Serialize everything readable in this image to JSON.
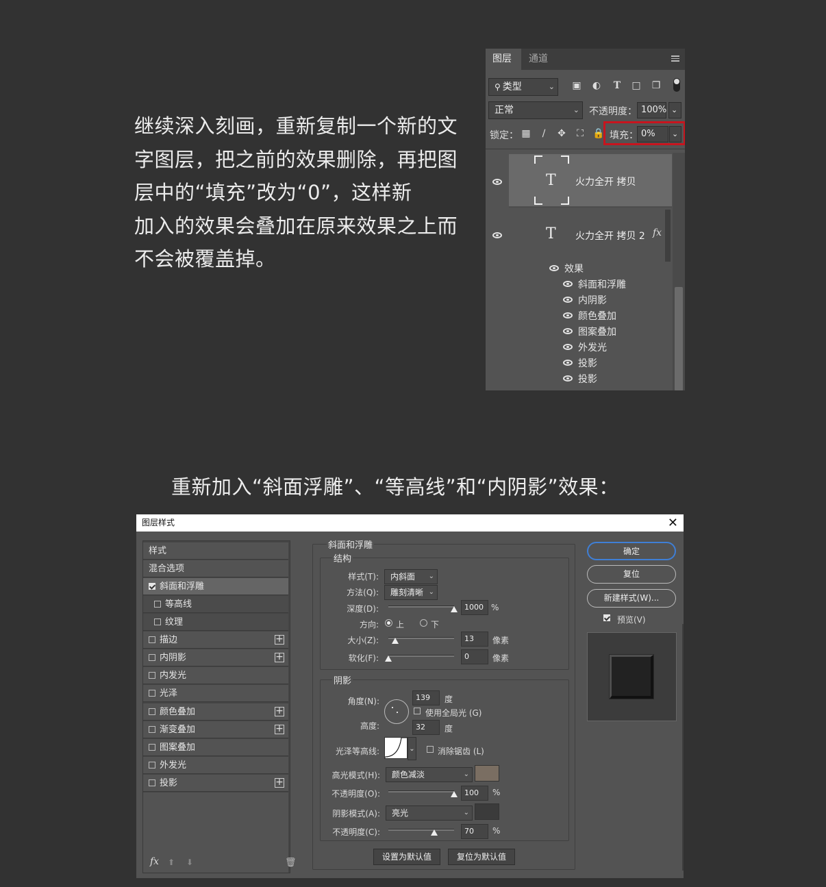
{
  "paragraph_lines": [
    "继续深入刻画，重新复制一个新的文",
    "字图层，把之前的效果删除，再把图",
    "层中的“填充”改为“0”，这样新",
    "加入的效果会叠加在原来效果之上而",
    "不会被覆盖掉。"
  ],
  "heading2": "重新加入“斜面浮雕”、“等高线”和“内阴影”效果：",
  "layers_panel": {
    "tabs": [
      "图层",
      "通道"
    ],
    "filter": {
      "search_icon": "search-icon",
      "value": "类型"
    },
    "blend_mode": "正常",
    "opacity_label": "不透明度：",
    "opacity_value": "100%",
    "lock_label": "锁定：",
    "fill_label": "填充：",
    "fill_value": "0%",
    "layers": [
      {
        "name": "火力全开 拷贝",
        "selected": true
      },
      {
        "name": "火力全开 拷贝 2",
        "fx": "fx"
      }
    ],
    "effects_label": "效果",
    "effects": [
      "斜面和浮雕",
      "内阴影",
      "颜色叠加",
      "图案叠加",
      "外发光",
      "投影",
      "投影"
    ]
  },
  "dialog": {
    "title": "图层样式",
    "left_items": [
      {
        "label": "样式",
        "type": "header"
      },
      {
        "label": "混合选项",
        "type": "header"
      },
      {
        "label": "斜面和浮雕",
        "checked": true,
        "selected": true
      },
      {
        "label": "等高线",
        "checked": false,
        "sub": true
      },
      {
        "label": "纹理",
        "checked": false,
        "sub": true
      },
      {
        "label": "描边",
        "checked": false,
        "plus": true
      },
      {
        "label": "内阴影",
        "checked": false,
        "plus": true
      },
      {
        "label": "内发光",
        "checked": false
      },
      {
        "label": "光泽",
        "checked": false
      },
      {
        "label": "颜色叠加",
        "checked": false,
        "plus": true
      },
      {
        "label": "渐变叠加",
        "checked": false,
        "plus": true
      },
      {
        "label": "图案叠加",
        "checked": false
      },
      {
        "label": "外发光",
        "checked": false
      },
      {
        "label": "投影",
        "checked": false,
        "plus": true
      }
    ],
    "bevel": {
      "section": "斜面和浮雕",
      "structure": "结构",
      "style_label": "样式(T):",
      "style_value": "内斜面",
      "technique_label": "方法(Q):",
      "technique_value": "雕刻清晰",
      "depth_label": "深度(D):",
      "depth_value": "1000",
      "depth_unit": "%",
      "depth_level": 1.0,
      "direction_label": "方向:",
      "dir_up": "上",
      "dir_down": "下",
      "size_label": "大小(Z):",
      "size_value": "13",
      "size_unit": "像素",
      "size_level": 0.1,
      "soften_label": "软化(F):",
      "soften_value": "0",
      "soften_unit": "像素",
      "soften_level": 0.0
    },
    "shading": {
      "section": "阴影",
      "angle_label": "角度(N):",
      "angle_value": "139",
      "angle_unit": "度",
      "global_light": "使用全局光 (G)",
      "altitude_label": "高度:",
      "altitude_value": "32",
      "altitude_unit": "度",
      "gloss_label": "光泽等高线:",
      "antialias": "消除锯齿 (L)",
      "highlight_label": "高光模式(H):",
      "highlight_value": "颜色减淡",
      "highlight_color": "#7a6e62",
      "hl_opacity_label": "不透明度(O):",
      "hl_opacity_value": "100",
      "hl_opacity_unit": "%",
      "hl_opacity_level": 1.0,
      "shadow_label": "阴影模式(A):",
      "shadow_value": "亮光",
      "shadow_color": "#3b3b3b",
      "sh_opacity_label": "不透明度(C):",
      "sh_opacity_value": "70",
      "sh_opacity_unit": "%",
      "sh_opacity_level": 0.7
    },
    "default_btn": "设置为默认值",
    "reset_default_btn": "复位为默认值",
    "ok": "确定",
    "reset": "复位",
    "new_style": "新建样式(W)...",
    "preview": "预览(V)",
    "fx_label": "fx"
  }
}
